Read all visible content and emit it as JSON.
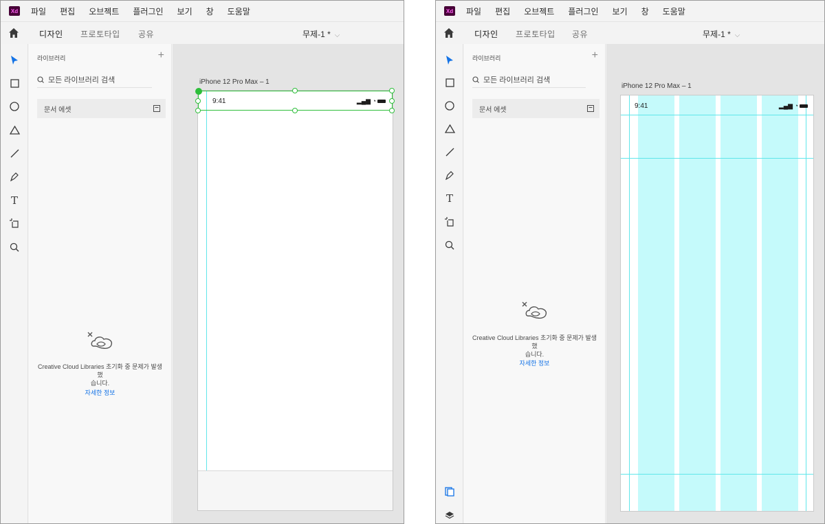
{
  "app": {
    "logo_text": "Xd",
    "brand_color": "#470137",
    "accent_color": "#1473e6"
  },
  "menu": [
    "파일",
    "편집",
    "오브젝트",
    "플러그인",
    "보기",
    "창",
    "도움말"
  ],
  "tabs": {
    "design": "디자인",
    "prototype": "프로토타입",
    "share": "공유"
  },
  "document": {
    "title": "무제-1 *"
  },
  "library": {
    "title": "라이브러리",
    "search_placeholder": "모든 라이브러리 검색",
    "doc_assets": "문서 에셋",
    "error_line1": "Creative Cloud Libraries 초기화 중 문제가 발생했",
    "error_line2": "습니다.",
    "details_link": "자세한 정보"
  },
  "artboard": {
    "name": "iPhone 12 Pro Max – 1",
    "time": "9:41"
  },
  "colors": {
    "selection": "#2dbe3a",
    "grid_column": "#c5fafb",
    "guide": "#5fe6ea"
  }
}
